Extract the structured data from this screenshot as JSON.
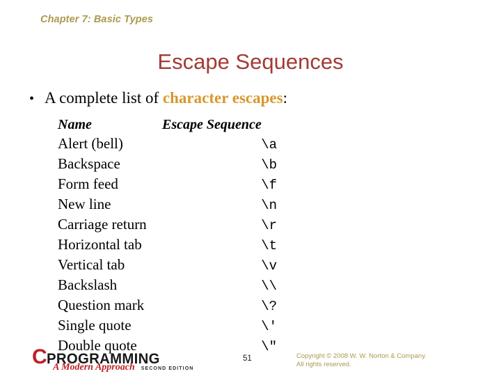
{
  "slide": {
    "chapter_header": "Chapter 7: Basic Types",
    "title": "Escape Sequences",
    "bullet": {
      "marker": "•",
      "lead_text": "A complete list of ",
      "emphasis_text": "character escapes",
      "trail_text": ":"
    },
    "table": {
      "headers": {
        "name": "Name",
        "sequence": "Escape Sequence"
      },
      "rows": [
        {
          "name": "Alert (bell)",
          "sequence": "\\a"
        },
        {
          "name": "Backspace",
          "sequence": "\\b"
        },
        {
          "name": "Form feed",
          "sequence": "\\f"
        },
        {
          "name": "New line",
          "sequence": "\\n"
        },
        {
          "name": "Carriage return",
          "sequence": "\\r"
        },
        {
          "name": "Horizontal tab",
          "sequence": "\\t"
        },
        {
          "name": "Vertical tab",
          "sequence": "\\v"
        },
        {
          "name": "Backslash",
          "sequence": "\\\\"
        },
        {
          "name": "Question mark",
          "sequence": "\\?"
        },
        {
          "name": "Single quote",
          "sequence": "\\'"
        },
        {
          "name": "Double quote",
          "sequence": "\\\""
        }
      ]
    },
    "footer": {
      "logo": {
        "letter": "C",
        "word": "PROGRAMMING",
        "subtitle": "A Modern Approach",
        "edition": "SECOND EDITION"
      },
      "page_number": "51",
      "copyright_line1": "Copyright © 2008 W. W. Norton & Company.",
      "copyright_line2": "All rights reserved."
    },
    "colors": {
      "chapter_header": "#ab9a4e",
      "title": "#a33a35",
      "emphasis": "#d8982d",
      "logo_red": "#be2026",
      "copyright": "#ab9a4e",
      "body_text": "#000000",
      "background": "#ffffff"
    }
  }
}
